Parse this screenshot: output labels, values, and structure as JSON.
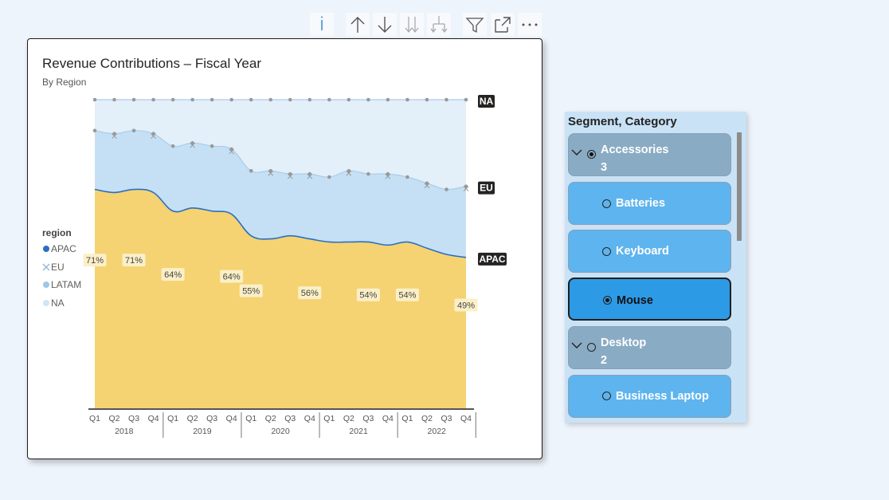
{
  "toolbar": {
    "icons": [
      "info-icon",
      "arrow-up-icon",
      "arrow-down-icon",
      "double-arrow-down-icon",
      "expand-hierarchy-icon",
      "filter-icon",
      "focus-mode-icon",
      "more-options-icon"
    ],
    "info_label": "i"
  },
  "chart_data": {
    "type": "area",
    "title": "Revenue Contributions – Fiscal Year",
    "subtitle": "By Region",
    "legend": {
      "title": "region",
      "position": "left",
      "items": [
        {
          "name": "APAC",
          "marker": "dot",
          "color": "#2b6fc0"
        },
        {
          "name": "EU",
          "marker": "x",
          "color": "#8fb8dc"
        },
        {
          "name": "LATAM",
          "marker": "dot",
          "color": "#9ec7e8"
        },
        {
          "name": "NA",
          "marker": "dot",
          "color": "#cfe4f6"
        }
      ]
    },
    "x": {
      "quarters": [
        "Q1",
        "Q2",
        "Q3",
        "Q4",
        "Q1",
        "Q2",
        "Q3",
        "Q4",
        "Q1",
        "Q2",
        "Q3",
        "Q4",
        "Q1",
        "Q2",
        "Q3",
        "Q4",
        "Q1",
        "Q2",
        "Q3",
        "Q4"
      ],
      "years": [
        "2018",
        "2019",
        "2020",
        "2021",
        "2022"
      ]
    },
    "stacked_percent": true,
    "series": [
      {
        "name": "APAC",
        "color": "#f5d372",
        "values": [
          71,
          70,
          71,
          70,
          64,
          65,
          64,
          63,
          56,
          55,
          56,
          55,
          54,
          54,
          54,
          53,
          54,
          52,
          50,
          49
        ]
      },
      {
        "name": "EU",
        "color": "#c5e0f5",
        "values": [
          19,
          19,
          19,
          19,
          21,
          21,
          21,
          21,
          21,
          22,
          20,
          21,
          21,
          23,
          22,
          23,
          21,
          21,
          21,
          23
        ]
      },
      {
        "name": "LATAM",
        "color": "#c5e0f5",
        "values": [
          10,
          11,
          10,
          11,
          15,
          14,
          15,
          16,
          23,
          23,
          24,
          24,
          25,
          23,
          24,
          24,
          25,
          27,
          29,
          28
        ]
      }
    ],
    "data_labels": [
      {
        "index": 0,
        "text": "71%"
      },
      {
        "index": 2,
        "text": "71%"
      },
      {
        "index": 4,
        "text": "64%"
      },
      {
        "index": 7,
        "text": "64%"
      },
      {
        "index": 8,
        "text": "55%"
      },
      {
        "index": 11,
        "text": "56%"
      },
      {
        "index": 14,
        "text": "54%"
      },
      {
        "index": 16,
        "text": "54%"
      },
      {
        "index": 19,
        "text": "49%"
      }
    ],
    "end_labels": [
      "NA",
      "EU",
      "APAC"
    ],
    "ylim": [
      0,
      100
    ],
    "grid": false
  },
  "slicer": {
    "header": "Segment, Category",
    "items": [
      {
        "label": "Accessories",
        "count": "3",
        "type": "group",
        "selected": true
      },
      {
        "label": "Batteries",
        "type": "leaf",
        "selected": false
      },
      {
        "label": "Keyboard",
        "type": "leaf",
        "selected": false
      },
      {
        "label": "Mouse",
        "type": "leaf",
        "selected": true
      },
      {
        "label": "Desktop",
        "count": "2",
        "type": "group",
        "selected": false
      },
      {
        "label": "Business Laptop",
        "type": "leaf",
        "selected": false
      }
    ]
  }
}
